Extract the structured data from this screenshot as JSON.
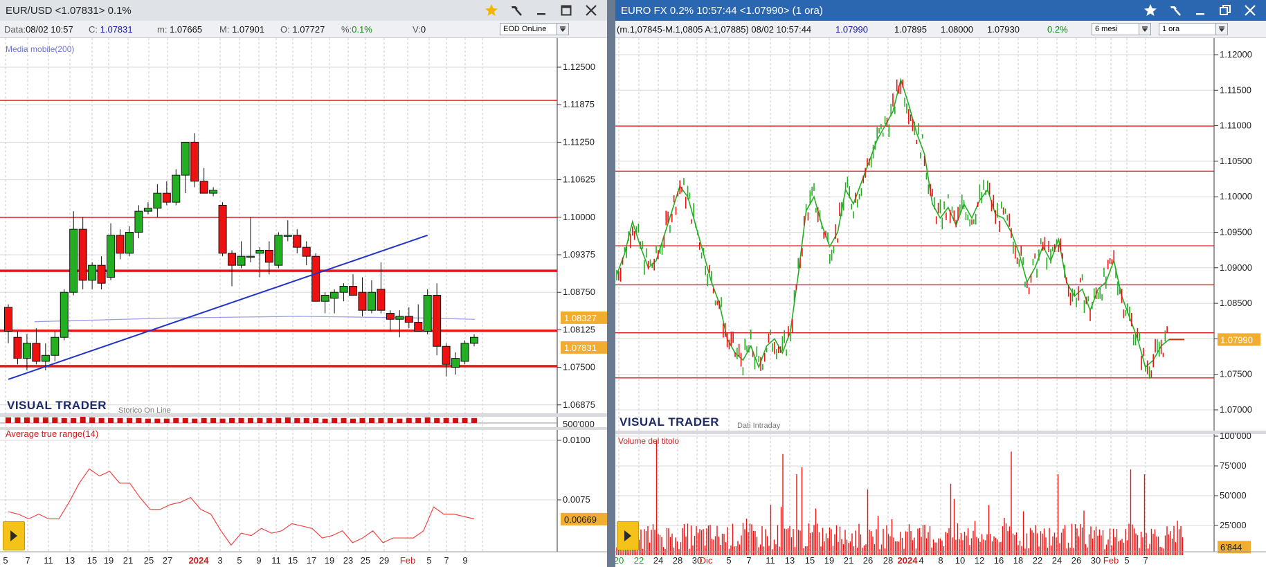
{
  "left": {
    "title": "EUR/USD <1.07831> 0.1%",
    "info": {
      "data_label": "Data:",
      "data_value": "08/02 10:57",
      "c_label": "C:",
      "c_value": "1.07831",
      "m_label": "m:",
      "m_value": "1.07665",
      "M_label": "M:",
      "M_value": "1.07901",
      "o_label": "O:",
      "o_value": "1.07727",
      "pct_label": "%:",
      "pct_value": "0.1%",
      "v_label": "V:",
      "v_value": "0"
    },
    "source_select": "EOD OnLine",
    "indicator_label": "Media mobile(200)",
    "brand": "VISUAL TRADER",
    "brand_sub": "Storico On Line",
    "volume_scale": "500'000",
    "atr_label": "Average true range(14)",
    "price_ticks": [
      "1.12500",
      "1.11875",
      "1.11250",
      "1.10625",
      "1.10000",
      "1.09375",
      "1.08750",
      "1.08125",
      "1.07500",
      "1.06875"
    ],
    "badge_ma": "1.08327",
    "badge_price": "1.07831",
    "atr_ticks": [
      "0.0100",
      "0.0075"
    ],
    "badge_atr": "0.00669",
    "x_labels": [
      "5",
      "7",
      "11",
      "13",
      "15",
      "19",
      "21",
      "25",
      "27",
      "2024",
      "3",
      "5",
      "9",
      "11",
      "15",
      "17",
      "19",
      "23",
      "25",
      "29",
      "Feb",
      "5",
      "7",
      "9"
    ]
  },
  "right": {
    "title": "EURO FX 0.2% 10:57:44 <1.07990> (1 ora)",
    "info": {
      "range": "(m.1,07845-M.1,0805 A:1,07885) 08/02 10:57:44",
      "last": "1.07990",
      "v1": "1.07895",
      "v2": "1.08000",
      "v3": "1.07930",
      "pct": "0.2%"
    },
    "period_select": "6 mesi",
    "interval_select": "1 ora",
    "brand": "VISUAL TRADER",
    "brand_sub": "Dati Intraday",
    "volume_label": "Volume del titolo",
    "price_ticks": [
      "1.12000",
      "1.11500",
      "1.11000",
      "1.10500",
      "1.10000",
      "1.09500",
      "1.09000",
      "1.08500",
      "1.08000",
      "1.07500",
      "1.07000"
    ],
    "badge_price": "1.07990",
    "volume_ticks": [
      "100'000",
      "75'000",
      "50'000",
      "25'000"
    ],
    "badge_volume": "6'844",
    "x_labels": [
      "20",
      "22",
      "24",
      "28",
      "30",
      "Dic",
      "5",
      "7",
      "11",
      "13",
      "15",
      "19",
      "21",
      "26",
      "28",
      "2024",
      "4",
      "8",
      "10",
      "12",
      "16",
      "18",
      "22",
      "24",
      "26",
      "30",
      "Feb",
      "5",
      "7"
    ]
  },
  "colors": {
    "up": "#22b022",
    "down": "#ee1111",
    "support": "#e21b1b",
    "trend": "#2233cc",
    "ma": "#9a9ee6",
    "badge": "#f0ad30",
    "right_title": "#2b67b0"
  },
  "chart_data": [
    {
      "type": "candlestick",
      "title": "EUR/USD",
      "x": [
        "5",
        "7",
        "11",
        "13",
        "15",
        "19",
        "21",
        "25",
        "27",
        "2024",
        "3",
        "5",
        "9",
        "11",
        "15",
        "17",
        "19",
        "23",
        "25",
        "29",
        "Feb",
        "5",
        "7",
        "9"
      ],
      "ylim": [
        1.0665,
        1.1285
      ],
      "candles": [
        [
          1.085,
          1.0855,
          1.079,
          1.081
        ],
        [
          1.08,
          1.081,
          1.0755,
          1.0765
        ],
        [
          1.0765,
          1.0805,
          1.0745,
          1.079
        ],
        [
          1.079,
          1.0815,
          1.0755,
          1.076
        ],
        [
          1.076,
          1.079,
          1.0745,
          1.077
        ],
        [
          1.077,
          1.081,
          1.076,
          1.08
        ],
        [
          1.08,
          1.088,
          1.0795,
          1.0875
        ],
        [
          1.0875,
          1.101,
          1.087,
          1.098
        ],
        [
          1.098,
          1.1,
          1.088,
          1.0895
        ],
        [
          1.0895,
          1.0925,
          1.088,
          1.092
        ],
        [
          1.092,
          1.0935,
          1.088,
          1.089
        ],
        [
          1.09,
          1.099,
          1.0895,
          1.097
        ],
        [
          1.097,
          1.098,
          1.093,
          1.094
        ],
        [
          1.094,
          1.0985,
          1.0935,
          1.0975
        ],
        [
          1.0975,
          1.102,
          1.0965,
          1.101
        ],
        [
          1.101,
          1.1025,
          1.1005,
          1.1015
        ],
        [
          1.1015,
          1.1055,
          1.1,
          1.104
        ],
        [
          1.104,
          1.106,
          1.102,
          1.1025
        ],
        [
          1.1025,
          1.108,
          1.102,
          1.107
        ],
        [
          1.107,
          1.112,
          1.104,
          1.1125
        ],
        [
          1.1125,
          1.114,
          1.105,
          1.106
        ],
        [
          1.106,
          1.1082,
          1.1045,
          1.104
        ],
        [
          1.104,
          1.105,
          1.1035,
          1.1045
        ],
        [
          1.102,
          1.1025,
          1.0935,
          1.094
        ],
        [
          1.094,
          1.0945,
          1.0885,
          1.092
        ],
        [
          1.092,
          1.096,
          1.0915,
          1.0935
        ],
        [
          1.0935,
          1.1,
          1.0925,
          1.0935
        ],
        [
          1.094,
          1.095,
          1.09,
          1.0945
        ],
        [
          1.0945,
          1.096,
          1.0905,
          1.0925
        ],
        [
          1.092,
          1.0975,
          1.0915,
          1.097
        ],
        [
          1.097,
          1.0995,
          1.096,
          1.097
        ],
        [
          1.097,
          1.098,
          1.094,
          1.095
        ],
        [
          1.095,
          1.096,
          1.092,
          1.0935
        ],
        [
          1.0935,
          1.094,
          1.0865,
          1.086
        ],
        [
          1.086,
          1.0875,
          1.084,
          1.087
        ],
        [
          1.0865,
          1.088,
          1.084,
          1.0875
        ],
        [
          1.0875,
          1.089,
          1.086,
          1.0885
        ],
        [
          1.0885,
          1.0905,
          1.087,
          1.087
        ],
        [
          1.0875,
          1.09,
          1.0835,
          1.0845
        ],
        [
          1.0845,
          1.0895,
          1.084,
          1.0875
        ],
        [
          1.088,
          1.0925,
          1.084,
          1.0845
        ],
        [
          1.084,
          1.0845,
          1.081,
          1.083
        ],
        [
          1.083,
          1.0845,
          1.08,
          1.0835
        ],
        [
          1.0835,
          1.085,
          1.0815,
          1.0825
        ],
        [
          1.0825,
          1.0855,
          1.081,
          1.081
        ],
        [
          1.081,
          1.088,
          1.0805,
          1.087
        ],
        [
          1.087,
          1.089,
          1.077,
          1.0785
        ],
        [
          1.0785,
          1.079,
          1.0735,
          1.0755
        ],
        [
          1.075,
          1.0775,
          1.0738,
          1.0765
        ],
        [
          1.076,
          1.0795,
          1.0755,
          1.079
        ],
        [
          1.079,
          1.0805,
          1.0785,
          1.08
        ]
      ],
      "ma_200": [
        1.0826,
        1.0828,
        1.083,
        1.0832,
        1.0833,
        1.0834,
        1.0835,
        1.0834,
        1.0833,
        1.0832,
        1.083
      ],
      "support_lines": [
        1.11947,
        1.09998,
        1.09109,
        1.0811,
        1.0752
      ],
      "trendline": [
        [
          0,
          1.073
        ],
        [
          45,
          1.097
        ]
      ],
      "last_price": 1.07831,
      "ma_value": 1.08327,
      "volume": [
        18,
        18,
        18,
        18,
        18,
        18,
        16,
        16,
        20,
        18,
        16,
        16,
        16,
        16,
        16,
        14,
        14,
        14,
        16,
        16,
        14,
        16,
        16,
        14,
        16,
        16,
        16,
        16,
        16,
        16,
        18,
        16,
        16,
        16,
        14,
        16,
        16,
        14,
        16,
        16,
        16,
        16,
        14,
        16,
        16,
        18,
        16,
        16,
        16,
        16,
        16
      ],
      "volume_scale": 500000,
      "atr_title": "Average true range(14)",
      "atr_ylim": [
        0.004,
        0.011
      ],
      "atr": [
        0.007,
        0.0069,
        0.0067,
        0.0069,
        0.0067,
        0.0067,
        0.0074,
        0.0082,
        0.0088,
        0.0085,
        0.0087,
        0.0082,
        0.0082,
        0.0076,
        0.0071,
        0.0071,
        0.0073,
        0.0074,
        0.0076,
        0.0071,
        0.0069,
        0.0062,
        0.0056,
        0.0061,
        0.006,
        0.0063,
        0.0061,
        0.0062,
        0.0065,
        0.0064,
        0.0063,
        0.0059,
        0.006,
        0.0062,
        0.0057,
        0.0059,
        0.0062,
        0.0057,
        0.0059,
        0.0059,
        0.0059,
        0.0062,
        0.0072,
        0.0069,
        0.0069,
        0.0068,
        0.0067
      ],
      "atr_value": 0.00669
    },
    {
      "type": "line",
      "title": "EURO FX",
      "x": [
        "20",
        "22",
        "24",
        "28",
        "30",
        "Dic",
        "5",
        "7",
        "11",
        "13",
        "15",
        "19",
        "21",
        "26",
        "28",
        "2024",
        "4",
        "8",
        "10",
        "12",
        "16",
        "18",
        "22",
        "24",
        "26",
        "30",
        "Feb",
        "5",
        "7"
      ],
      "ylim": [
        1.068,
        1.123
      ],
      "series": [
        {
          "values": [
            1.089,
            1.092,
            1.0965,
            1.093,
            1.09,
            1.091,
            1.0945,
            1.098,
            1.1015,
            1.1,
            1.096,
            1.092,
            1.088,
            1.085,
            1.08,
            1.078,
            1.077,
            1.079,
            1.076,
            1.079,
            1.08,
            1.078,
            1.081,
            1.089,
            1.098,
            1.1,
            1.096,
            1.093,
            1.095,
            1.101,
            1.099,
            1.102,
            1.105,
            1.108,
            1.11,
            1.112,
            1.1165,
            1.113,
            1.109,
            1.106,
            1.099,
            1.097,
            1.0985,
            1.096,
            1.099,
            1.097,
            1.0995,
            1.101,
            1.0975,
            1.097,
            1.095,
            1.092,
            1.088,
            1.09,
            1.093,
            1.091,
            1.094,
            1.088,
            1.086,
            1.087,
            1.084,
            1.087,
            1.088,
            1.091,
            1.086,
            1.083,
            1.08,
            1.076,
            1.077,
            1.079,
            1.0799
          ]
        }
      ],
      "support_lines": [
        1.10995,
        1.1036,
        1.0931,
        1.0876,
        1.08085,
        1.0745
      ],
      "last_price": 1.0799,
      "volume_title": "Volume del titolo",
      "volume_ylim": [
        0,
        100000
      ],
      "volume_value": 6844
    }
  ]
}
